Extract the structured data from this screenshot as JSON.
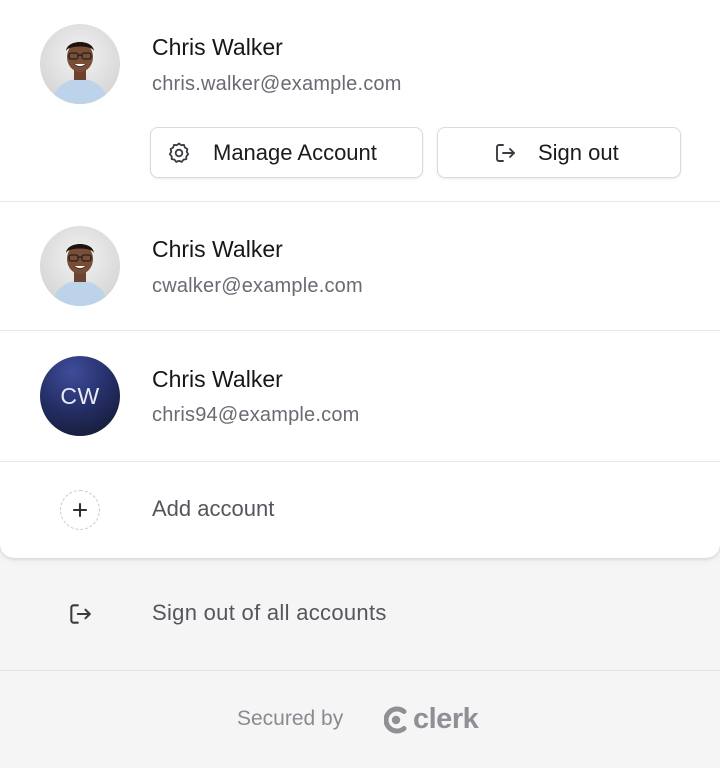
{
  "active_account": {
    "name": "Chris Walker",
    "email": "chris.walker@example.com",
    "manage_label": "Manage Account",
    "signout_label": "Sign out"
  },
  "accounts": [
    {
      "name": "Chris Walker",
      "email": "cwalker@example.com",
      "avatar": "photo"
    },
    {
      "name": "Chris Walker",
      "email": "chris94@example.com",
      "avatar": "initials",
      "initials": "CW"
    }
  ],
  "add_account_label": "Add account",
  "signout_all_label": "Sign out of all accounts",
  "footer": {
    "secured_by": "Secured by",
    "brand": "clerk"
  },
  "icons": {
    "manage": "gear-icon",
    "signout": "sign-out-icon",
    "add": "plus-icon",
    "signout_all": "sign-out-icon",
    "brand": "clerk-logo-icon"
  },
  "colors": {
    "primary_text": "#161619",
    "secondary_text": "#6a6a73",
    "muted_text": "#8a8a92",
    "initials_avatar": "#26306a",
    "footer_bg": "#f5f5f5"
  }
}
